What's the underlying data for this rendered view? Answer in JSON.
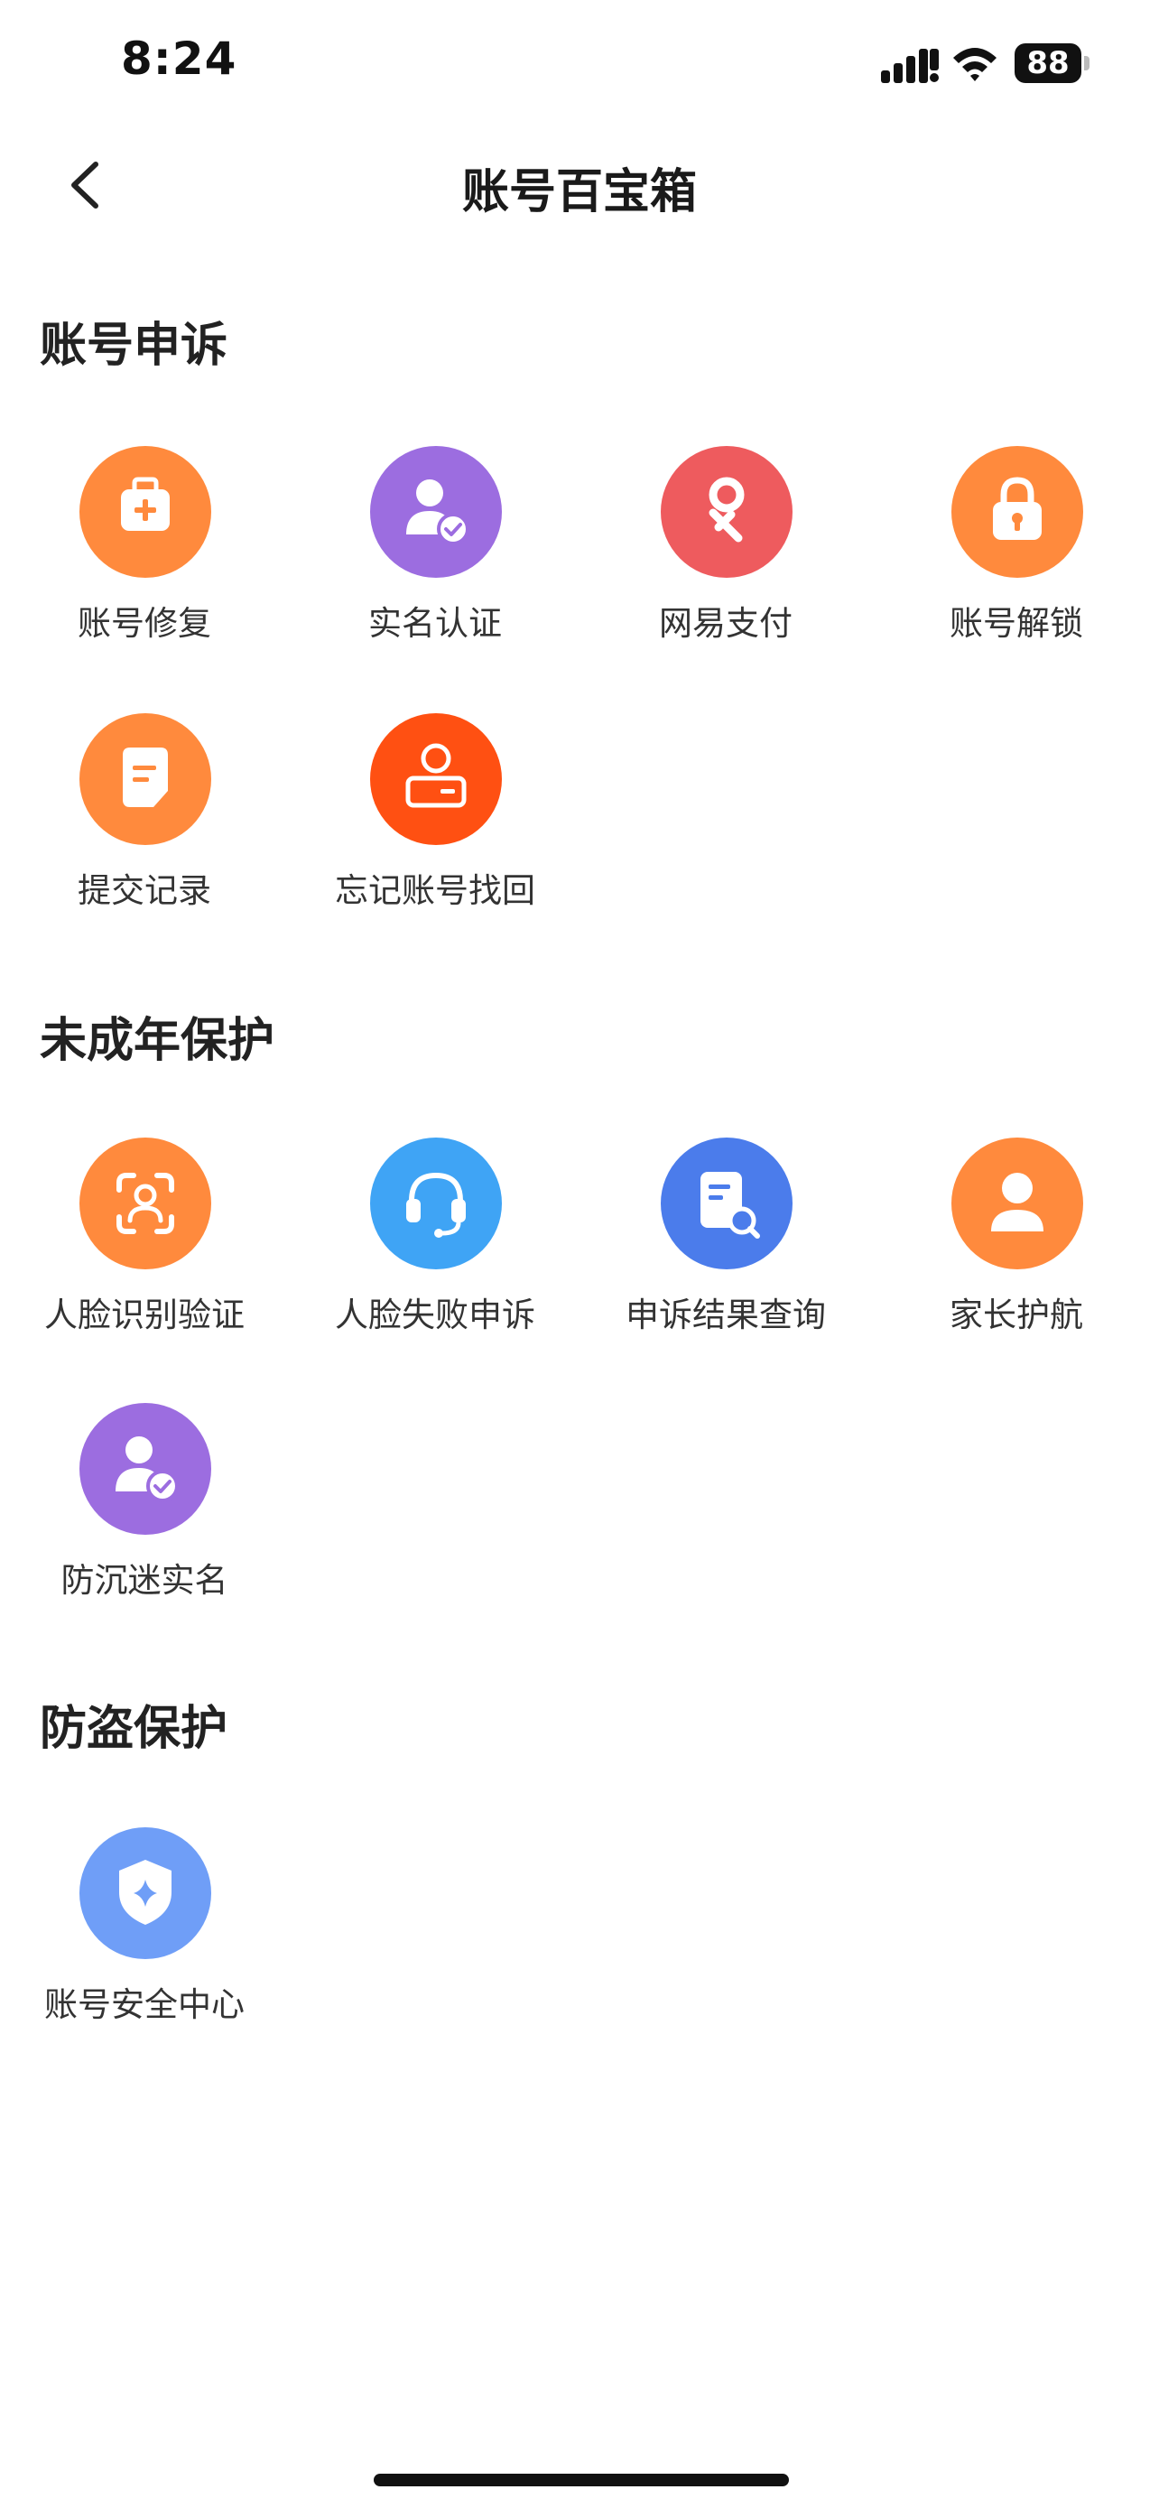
{
  "status": {
    "time": "8:24",
    "battery": "88"
  },
  "header": {
    "title": "账号百宝箱"
  },
  "sections": [
    {
      "title": "账号申诉",
      "items": [
        {
          "label": "账号修复",
          "icon": "medical-kit-icon",
          "color": "#FF8A3D"
        },
        {
          "label": "实名认证",
          "icon": "user-verified-icon",
          "color": "#9C6DE0"
        },
        {
          "label": "网易支付",
          "icon": "netease-pay-icon",
          "color": "#EE5B5E"
        },
        {
          "label": "账号解锁",
          "icon": "lock-icon",
          "color": "#FF8A3D"
        },
        {
          "label": "提交记录",
          "icon": "document-icon",
          "color": "#FF8A3D"
        },
        {
          "label": "忘记账号找回",
          "icon": "user-card-icon",
          "color": "#FF5012"
        }
      ]
    },
    {
      "title": "未成年保护",
      "items": [
        {
          "label": "人脸识别验证",
          "icon": "face-scan-icon",
          "color": "#FF8A3D"
        },
        {
          "label": "人脸失败申诉",
          "icon": "headset-icon",
          "color": "#3FA4F5"
        },
        {
          "label": "申诉结果查询",
          "icon": "document-search-icon",
          "color": "#4B7CEB"
        },
        {
          "label": "家长护航",
          "icon": "parent-user-icon",
          "color": "#FF8A3D"
        },
        {
          "label": "防沉迷实名",
          "icon": "user-verified-icon",
          "color": "#9C6DE0"
        }
      ]
    },
    {
      "title": "防盗保护",
      "items": [
        {
          "label": "账号安全中心",
          "icon": "shield-icon",
          "color": "#6F9EF7"
        }
      ]
    }
  ]
}
